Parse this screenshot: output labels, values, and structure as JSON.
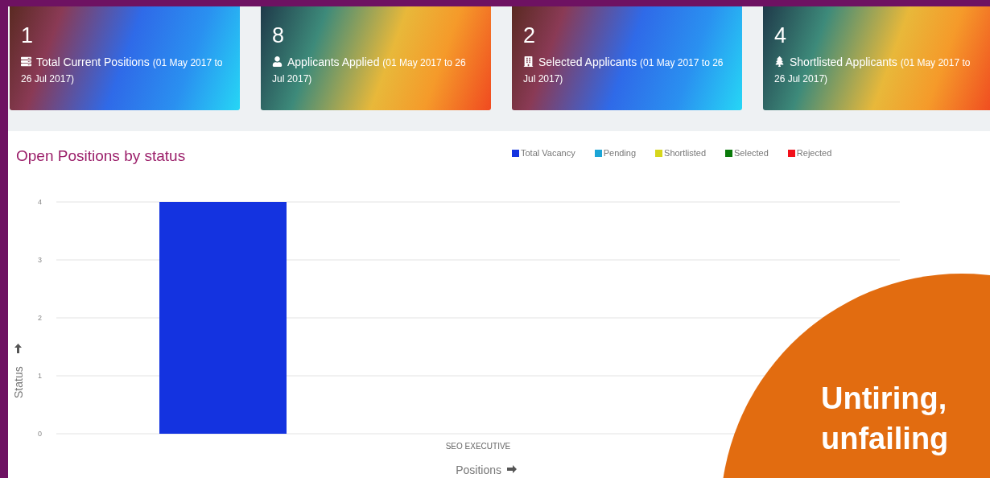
{
  "stat_cards": [
    {
      "value": "1",
      "label": "Total Current Positions",
      "period": "(01 May 2017 to 26 Jul 2017)"
    },
    {
      "value": "8",
      "label": "Applicants Applied",
      "period": "(01 May 2017 to 26 Jul 2017)"
    },
    {
      "value": "2",
      "label": "Selected Applicants",
      "period": "(01 May 2017 to 26 Jul 2017)"
    },
    {
      "value": "4",
      "label": "Shortlisted Applicants",
      "period": "(01 May 2017 to 26 Jul 2017)"
    }
  ],
  "chart_panel": {
    "title": "Open Positions by status",
    "chart_data": {
      "type": "bar",
      "xlabel": "Positions",
      "ylabel": "Status",
      "categories": [
        "SEO EXECUTIVE"
      ],
      "series": [
        {
          "name": "Total Vacancy",
          "color": "#1433e0",
          "values": [
            4
          ]
        },
        {
          "name": "Pending",
          "color": "#1ca5d6",
          "values": [
            0
          ]
        },
        {
          "name": "Shortlisted",
          "color": "#d6d61c",
          "values": [
            0
          ]
        },
        {
          "name": "Selected",
          "color": "#0a7a0a",
          "values": [
            0
          ]
        },
        {
          "name": "Rejected",
          "color": "#f2101a",
          "values": [
            0
          ]
        }
      ],
      "ylim": [
        0,
        4
      ],
      "grid": true,
      "yticks": [
        0,
        1,
        2,
        3,
        4
      ]
    }
  },
  "promo_badge": {
    "lines": [
      "Untiring,",
      "unfailing"
    ]
  }
}
